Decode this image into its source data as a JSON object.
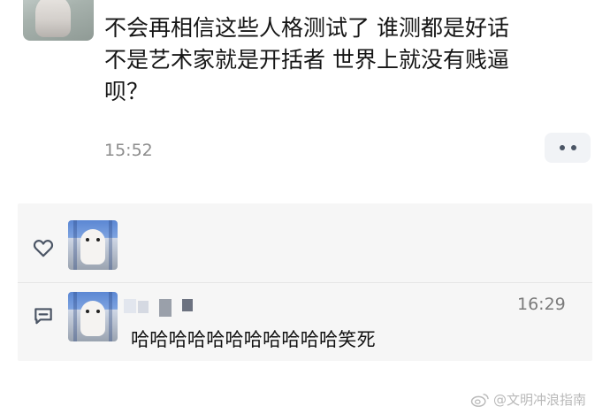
{
  "post": {
    "text": "不会再相信这些人格测试了 谁测都是好话\n不是艺术家就是开括者 世界上就没有贱逼\n呗？",
    "time": "15:52"
  },
  "interactions": {
    "like_icon": "heart-outline-icon",
    "comment_icon": "comment-bubble-icon"
  },
  "reply": {
    "time": "16:29",
    "text": "哈哈哈哈哈哈哈哈哈哈哈笑死"
  },
  "watermark": {
    "text": "@文明冲浪指南"
  },
  "colors": {
    "panel_bg": "#f6f6f6",
    "secondary_text": "#8d8d8d",
    "icon": "#4b5565"
  }
}
